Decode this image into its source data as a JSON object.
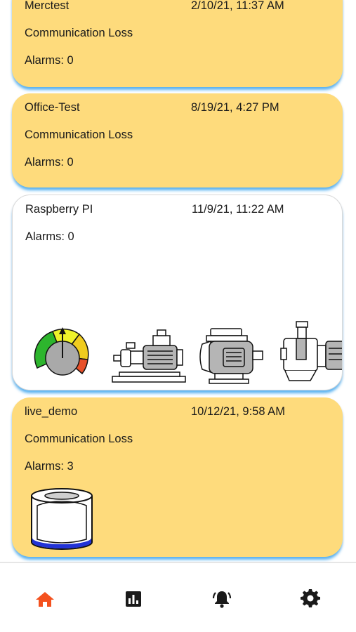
{
  "devices": [
    {
      "name": "Merctest",
      "date": "2/10/21, 11:37 AM",
      "status": "Communication Loss",
      "alarms": "Alarms: 0"
    },
    {
      "name": "Office-Test",
      "date": "8/19/21, 4:27 PM",
      "status": "Communication Loss",
      "alarms": "Alarms: 0"
    },
    {
      "name": "Raspberry PI",
      "date": "11/9/21, 11:22 AM",
      "alarms": "Alarms: 0",
      "widgets": [
        "gauge-icon",
        "pump-icon",
        "motor-icon",
        "pump-icon"
      ]
    },
    {
      "name": "live_demo",
      "date": "10/12/21, 9:58 AM",
      "status": "Communication Loss",
      "alarms": "Alarms: 3",
      "widgets": [
        "tank-icon"
      ]
    }
  ],
  "nav": {
    "items": [
      {
        "icon": "home-icon",
        "active": true
      },
      {
        "icon": "chart-icon",
        "active": false
      },
      {
        "icon": "bell-icon",
        "active": false
      },
      {
        "icon": "gear-icon",
        "active": false
      }
    ]
  },
  "colors": {
    "warning_card": "#FEDB7C",
    "normal_card": "#FFFFFF",
    "card_glow": "#42AAF5",
    "nav_active": "#F4511E",
    "nav_inactive": "#1A1A1A"
  }
}
